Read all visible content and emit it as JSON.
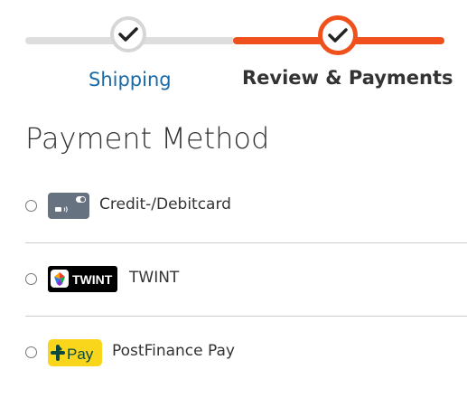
{
  "checkout_steps": {
    "steps": [
      {
        "label": "Shipping",
        "status": "completed"
      },
      {
        "label": "Review & Payments",
        "status": "current"
      }
    ],
    "colors": {
      "active": "#f0501c",
      "inactive": "#dedede",
      "link": "#1a6aa7"
    }
  },
  "payment": {
    "title": "Payment Method",
    "methods": [
      {
        "label": "Credit-/Debitcard",
        "icon": "credit-card-icon",
        "selected": false
      },
      {
        "label": "TWINT",
        "icon": "twint-logo",
        "logo_text": "TWINT",
        "selected": false
      },
      {
        "label": "PostFinance Pay",
        "icon": "postfinance-pay-logo",
        "logo_text": "Pay",
        "selected": false
      }
    ]
  }
}
